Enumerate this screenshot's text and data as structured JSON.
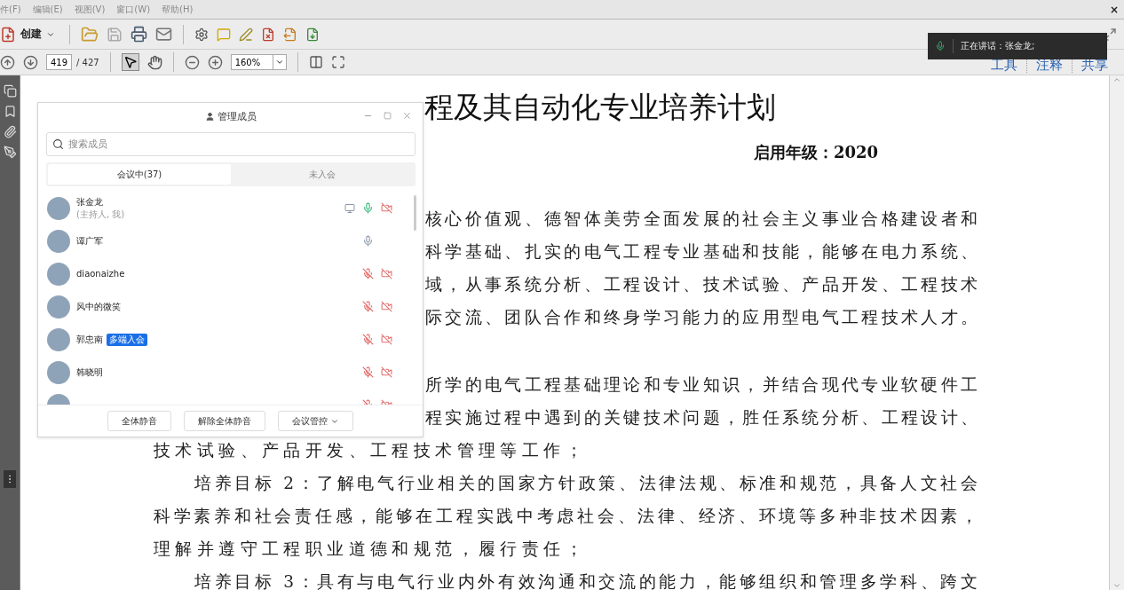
{
  "menu_bar": {
    "items": [
      "件(F)",
      "编辑(E)",
      "视图(V)",
      "窗口(W)",
      "帮助(H)"
    ],
    "close_label": "×"
  },
  "toolbar": {
    "create_label": "创建"
  },
  "nav_bar": {
    "page": "419",
    "page_total": "/ 427",
    "zoom": "160%",
    "links": [
      "工具",
      "注释",
      "共享"
    ]
  },
  "toast": {
    "text": "正在讲话：张金龙;"
  },
  "document": {
    "title": "程及其自动化专业培养计划",
    "grade": "启用年级：2020",
    "lines": [
      {
        "kind": "partial",
        "text": "核心价值观、德智体美劳全面发展的社会主义事业合格建设者和"
      },
      {
        "kind": "partial",
        "text": "科学基础、扎实的电气工程专业基础和技能，能够在电力系统、"
      },
      {
        "kind": "partial",
        "text": "域，从事系统分析、工程设计、技术试验、产品开发、工程技术"
      },
      {
        "kind": "partial",
        "text": "际交流、团队合作和终身学习能力的应用型电气工程技术人才。"
      },
      {
        "kind": "gap"
      },
      {
        "kind": "partial",
        "text": "所学的电气工程基础理论和专业知识，并结合现代专业软硬件工"
      },
      {
        "kind": "partial",
        "text": "程实施过程中遇到的关键技术问题，胜任系统分析、工程设计、"
      },
      {
        "kind": "end",
        "text": "技术试验、产品开发、工程技术管理等工作；"
      },
      {
        "kind": "start",
        "text": "培养目标 2：了解电气行业相关的国家方针政策、法律法规、标准和规范，具备人文社会"
      },
      {
        "kind": "cont",
        "text": "科学素养和社会责任感，能够在工程实践中考虑社会、法律、经济、环境等多种非技术因素，"
      },
      {
        "kind": "end",
        "text": "理解并遵守工程职业道德和规范，履行责任；"
      },
      {
        "kind": "start",
        "text": "培养目标 3：具有与电气行业内外有效沟通和交流的能力，能够组织和管理多学科、跨文"
      }
    ]
  },
  "members_panel": {
    "title": "管理成员",
    "search": {
      "placeholder": "搜索成员"
    },
    "tabs": [
      {
        "label": "会议中(37)",
        "selected": true
      },
      {
        "label": "未入会",
        "selected": false
      }
    ],
    "members": [
      {
        "name": "张金龙",
        "subtitle": "(主持人, 我)",
        "sharing": true,
        "muted": false,
        "speaking": true,
        "camera_icon": true
      },
      {
        "name": "谭广军",
        "sharing": false,
        "muted": false,
        "speaking": false,
        "camera_icon": false
      },
      {
        "name": "diaonaizhe",
        "sharing": false,
        "muted": true,
        "camera_icon": true
      },
      {
        "name": "风中的微笑",
        "sharing": false,
        "muted": true,
        "camera_icon": true
      },
      {
        "name": "郭忠南",
        "badge": "多端入会",
        "sharing": false,
        "muted": true,
        "camera_icon": true
      },
      {
        "name": "韩晓明",
        "sharing": false,
        "muted": true,
        "camera_icon": true
      },
      {
        "sharing": false,
        "muted": true,
        "camera_icon": true
      }
    ],
    "buttons": [
      {
        "label": "全体静音",
        "kind": "plain"
      },
      {
        "label": "解除全体静音",
        "kind": "plain"
      },
      {
        "label": "会议管控",
        "kind": "menu"
      }
    ]
  }
}
